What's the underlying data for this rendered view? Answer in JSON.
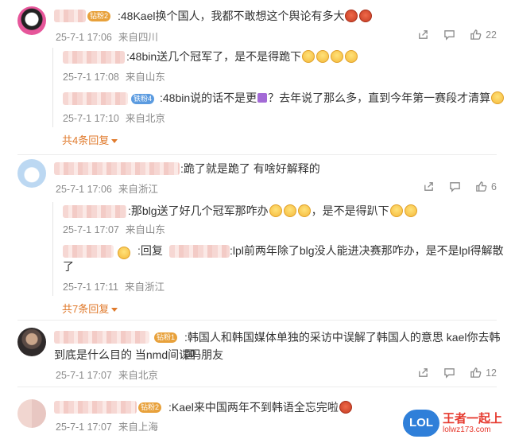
{
  "colors": {
    "accent_orange": "#e07a2c",
    "meta_gray": "#8a8a8a",
    "name_blur": "#f6d7d3"
  },
  "comments": [
    {
      "badge": "钻粉2",
      "text": ":48Kael换个国人，我都不敢想这个舆论有多大",
      "time": "25-7-1 17:06",
      "location": "来自四川",
      "likes": "22",
      "replies": [
        {
          "text": ":48bin送几个冠军了，是不是得跪下",
          "time": "25-7-1 17:08",
          "location": "来自山东"
        },
        {
          "badge": "铁粉4",
          "text": ":48bin说的话不是更",
          "text2": "？去年说了那么多，直到今年第一赛段才清算",
          "time": "25-7-1 17:10",
          "location": "来自北京"
        }
      ],
      "more": "共4条回复"
    },
    {
      "text": ":跪了就是跪了 有啥好解释的",
      "time": "25-7-1 17:06",
      "location": "来自浙江",
      "likes": "6",
      "replies": [
        {
          "text": ":那blg送了好几个冠军那咋办",
          "text2": "，是不是得趴下",
          "time": "25-7-1 17:07",
          "location": "来自山东"
        },
        {
          "prefix": ":回复",
          "text": ":lpl前两年除了blg没人能进决赛那咋办，是不是lpl得解散",
          "text_line2": "了",
          "time": "25-7-1 17:11",
          "location": "来自浙江"
        }
      ],
      "more": "共7条回复"
    },
    {
      "badge": "钻粉1",
      "text": ":韩国人和韩国媒体单独的采访中误解了韩国人的意思 kael你去韩国",
      "text_line2": "到底是什么目的 当nmd间谍吗朋友",
      "time": "25-7-1 17:07",
      "location": "来自北京",
      "likes": "12"
    },
    {
      "badge": "钻粉2",
      "text": ":Kael来中国两年不到韩语全忘完啦",
      "time": "25-7-1 17:07",
      "location": "来自上海"
    }
  ],
  "icons": [
    "share-icon",
    "comment-icon",
    "like-icon"
  ],
  "watermark": {
    "logo": "LOL",
    "site": "lolwz173.com",
    "slogan": "王者一起上"
  }
}
